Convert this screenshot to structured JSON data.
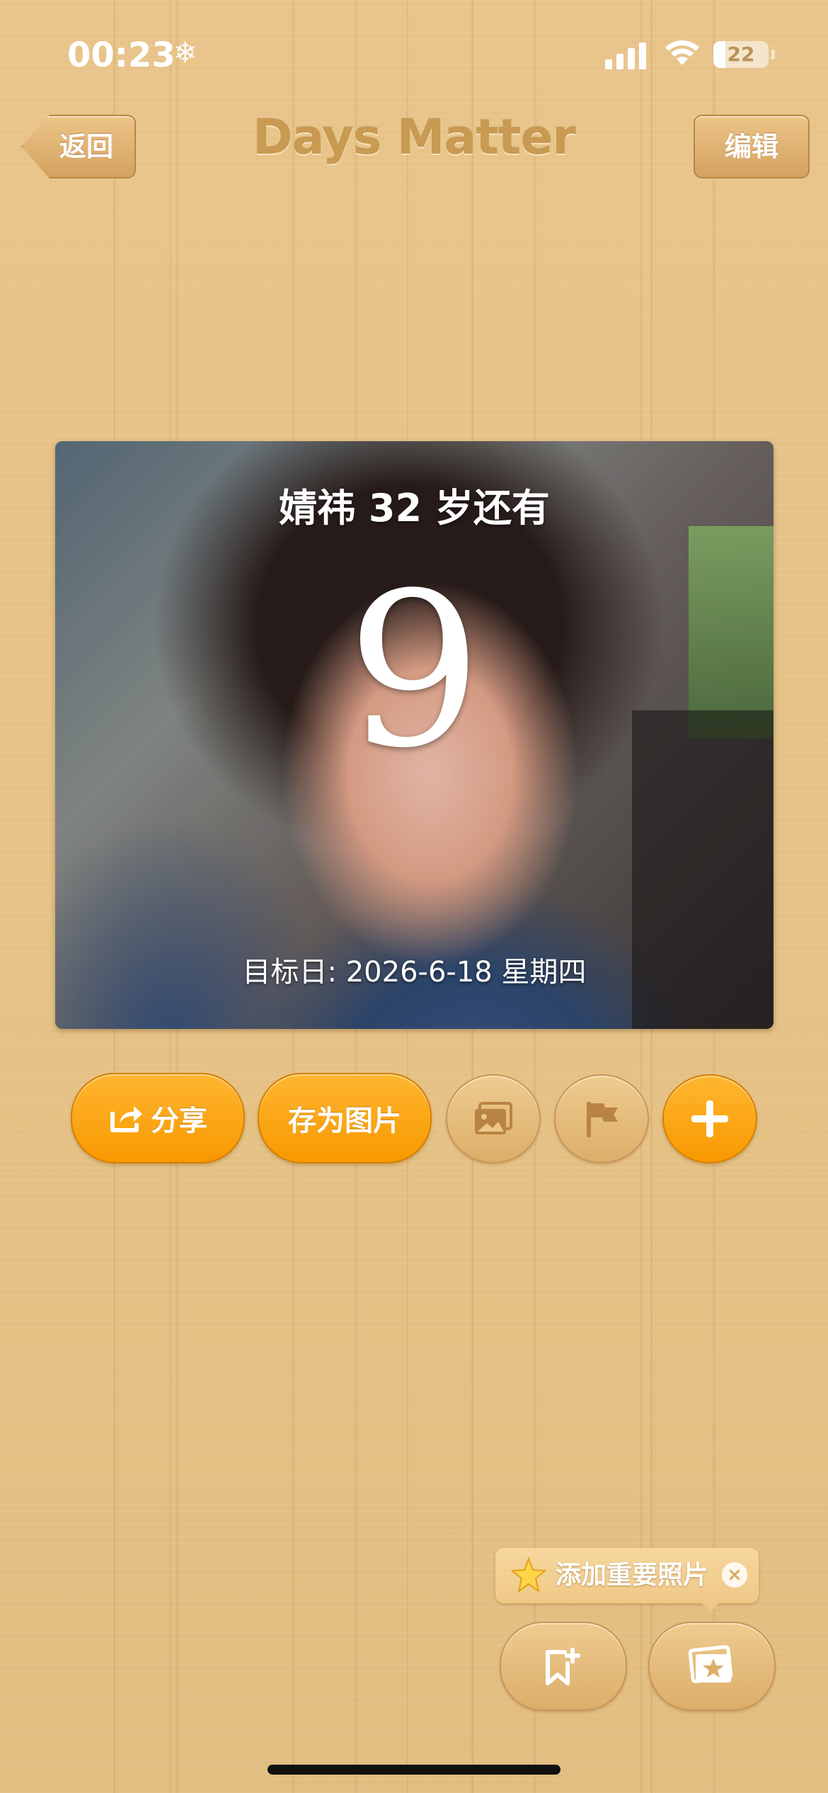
{
  "status_bar": {
    "time": "00:23",
    "time_icon": "❄",
    "battery": "22"
  },
  "nav": {
    "back_label": "返回",
    "title": "Days Matter",
    "edit_label": "编辑"
  },
  "card": {
    "title": "婧祎 32 岁还有",
    "days": "9",
    "target_date": "目标日: 2026-6-18 星期四"
  },
  "actions": {
    "share_label": "分享",
    "save_image_label": "存为图片"
  },
  "tooltip": {
    "text": "添加重要照片",
    "close": "×"
  },
  "colors": {
    "accent_orange": "#f89800",
    "wood": "#e6c286"
  }
}
